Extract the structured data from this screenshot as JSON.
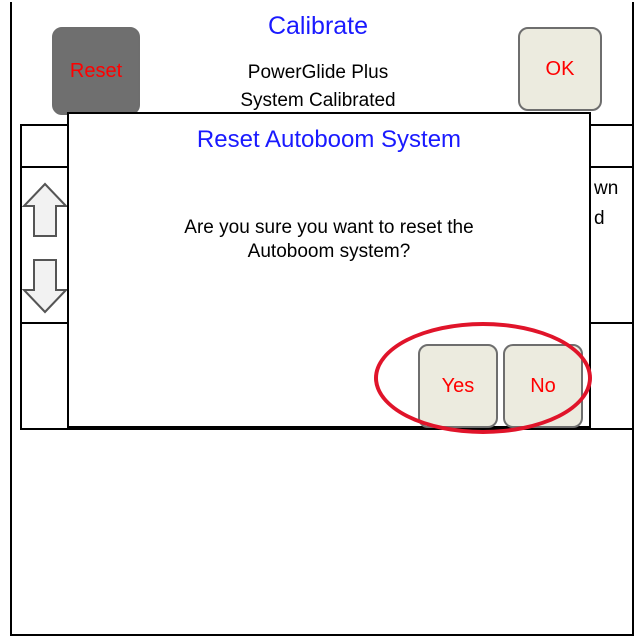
{
  "header": {
    "title": "Calibrate",
    "subtitle": "PowerGlide Plus",
    "status": "System Calibrated",
    "reset_label": "Reset",
    "ok_label": "OK"
  },
  "background": {
    "right_text_1": "wn",
    "right_text_2": "d"
  },
  "dialog": {
    "title": "Reset Autoboom System",
    "message_line1": "Are you sure you want to reset the",
    "message_line2": "Autoboom system?",
    "yes_label": "Yes",
    "no_label": "No"
  },
  "colors": {
    "title_blue": "#1a1aff",
    "button_text_red": "#ff0000",
    "highlight_circle": "#e0142a",
    "button_face": "#ecebdf",
    "reset_face": "#6f6f6f"
  }
}
